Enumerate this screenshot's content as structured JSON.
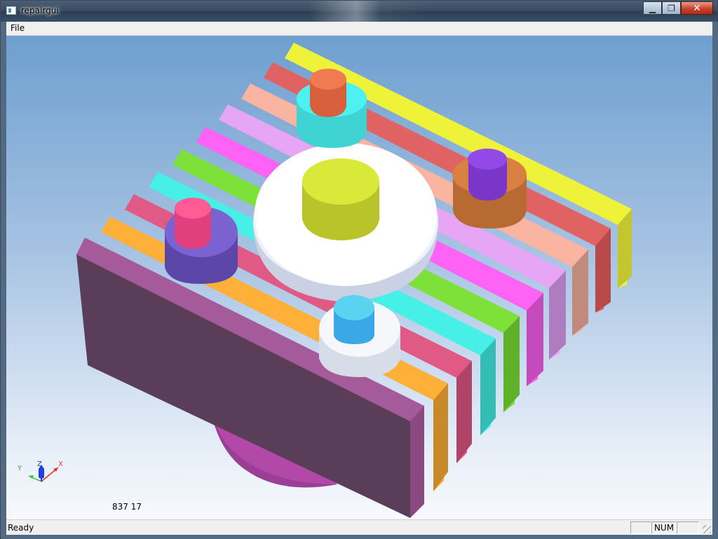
{
  "window": {
    "title": "repairgui",
    "caption_buttons": {
      "minimize": "▁",
      "maximize": "❐",
      "close": "✕"
    }
  },
  "menu": {
    "file": "File"
  },
  "viewport": {
    "coords_readout": "837 17",
    "triad": {
      "x_label": "X",
      "y_label": "Y",
      "z_label": "Z"
    },
    "colors": {
      "background_top": "#6e9fcf",
      "background_bottom": "#f7f9fc",
      "fins": [
        "#a55a9a",
        "#ffb039",
        "#e05a85",
        "#46f0e6",
        "#7ee13a",
        "#ff63f5",
        "#e7a5f5",
        "#fab4a2",
        "#e06262",
        "#eef238"
      ],
      "hub": "#ffffff",
      "hub_pin": "#d8e93a"
    }
  },
  "status": {
    "text": "Ready",
    "panes": [
      "",
      "NUM",
      ""
    ]
  }
}
